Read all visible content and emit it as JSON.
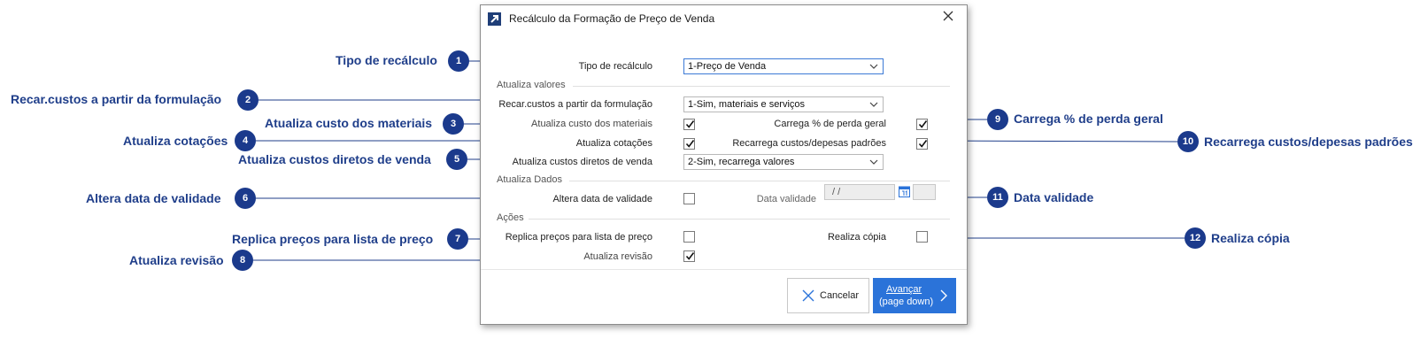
{
  "dialog": {
    "title": "Recálculo da Formação de Preço de Venda",
    "close_icon": "close-icon",
    "app_icon": "arrow-up-right-icon"
  },
  "form": {
    "tipo_label": "Tipo de recálculo",
    "tipo_value": "1-Preço de Venda",
    "section_valores": "Atualiza valores",
    "recar_label": "Recar.custos a partir da formulação",
    "recar_value": "1-Sim, materiais e serviços",
    "custo_materiais_label": "Atualiza custo dos materiais",
    "custo_materiais_checked": true,
    "cotacoes_label": "Atualiza cotações",
    "cotacoes_checked": true,
    "diretos_label": "Atualiza custos diretos de venda",
    "diretos_value": "2-Sim, recarrega valores",
    "perda_label": "Carrega % de perda geral",
    "perda_checked": true,
    "recarrega_label": "Recarrega custos/depesas padrões",
    "recarrega_checked": true,
    "section_dados": "Atualiza Dados",
    "altera_label": "Altera data de validade",
    "altera_checked": false,
    "data_validade_label": "Data validade",
    "data_validade_value": " / /",
    "section_acoes": "Ações",
    "replica_label": "Replica preços para lista de preço",
    "replica_checked": false,
    "realiza_label": "Realiza cópia",
    "realiza_checked": false,
    "revisao_label": "Atualiza revisão",
    "revisao_checked": true
  },
  "buttons": {
    "cancel_label": "Cancelar",
    "next_label_line1": "Avançar",
    "next_label_line2": "(page down)"
  },
  "annotations": [
    {
      "num": "1",
      "text": "Tipo de recálculo"
    },
    {
      "num": "2",
      "text": "Recar.custos a partir da formulação"
    },
    {
      "num": "3",
      "text": "Atualiza custo dos materiais"
    },
    {
      "num": "4",
      "text": "Atualiza cotações"
    },
    {
      "num": "5",
      "text": "Atualiza custos diretos de venda"
    },
    {
      "num": "6",
      "text": "Altera data de validade"
    },
    {
      "num": "7",
      "text": "Replica preços para lista de preço"
    },
    {
      "num": "8",
      "text": "Atualiza revisão"
    },
    {
      "num": "9",
      "text": "Carrega % de perda geral"
    },
    {
      "num": "10",
      "text": "Recarrega custos/depesas padrões"
    },
    {
      "num": "11",
      "text": "Data validade"
    },
    {
      "num": "12",
      "text": "Realiza cópia"
    }
  ],
  "colors": {
    "accent": "#2b73d9",
    "annotation": "#1f3e8a",
    "badge": "#1b3a8c"
  }
}
